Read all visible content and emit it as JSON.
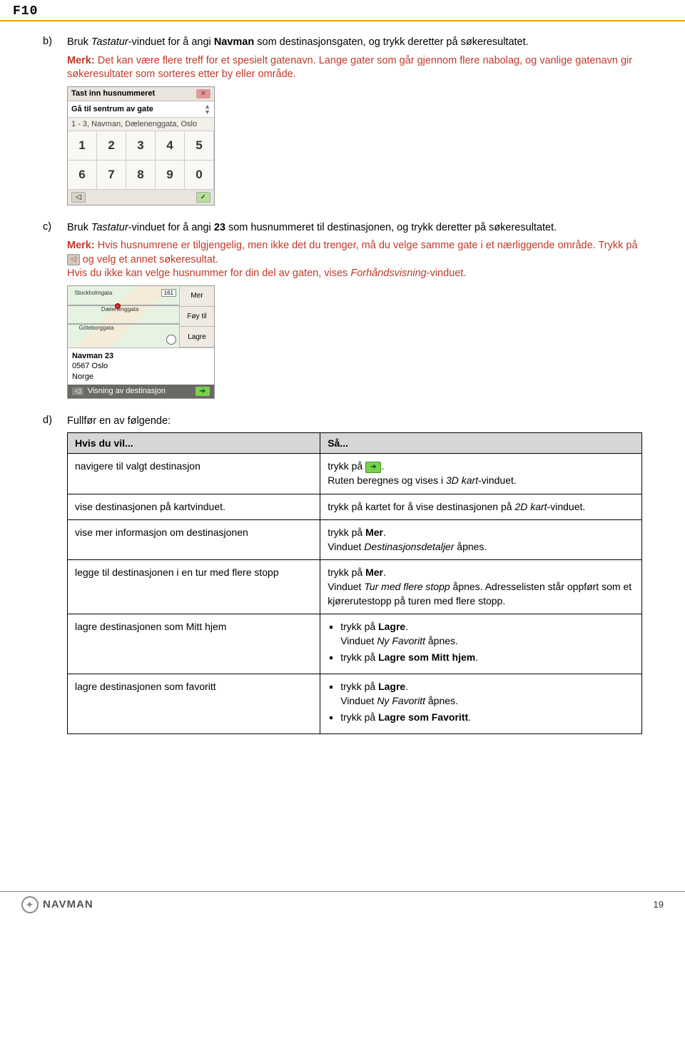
{
  "header": {
    "title": "F10"
  },
  "steps": {
    "b": {
      "letter": "b)",
      "text_pre": "Bruk ",
      "text_italic1": "Tastatur",
      "text_mid1": "-vinduet for å angi ",
      "text_bold1": "Navman",
      "text_post": " som destinasjonsgaten, og trykk deretter på søkeresultatet.",
      "note_label": "Merk:",
      "note_text": " Det kan være flere treff for et spesielt gatenavn. Lange gater som går gjennom flere nabolag, og vanlige gatenavn gir søkeresultater som sorteres etter by eller område."
    },
    "c": {
      "letter": "c)",
      "text_pre": "Bruk ",
      "text_italic1": "Tastatur",
      "text_mid1": "-vinduet for å angi ",
      "text_bold1": "23",
      "text_post": " som husnummeret til destinasjonen, og trykk deretter på søkeresultatet.",
      "note_label": "Merk:",
      "note_line1a": " Hvis husnumrene er tilgjengelig, men ikke det du trenger, må du velge samme gate i et nærliggende område. Trykk på ",
      "note_line1b": " og velg et annet søkeresultat.",
      "note_line2a": "Hvis du ikke kan velge husnummer for din del av gaten, vises ",
      "note_line2_italic": "Forhåndsvisning",
      "note_line2b": "-vinduet."
    },
    "d": {
      "letter": "d)",
      "text": "Fullfør en av følgende:"
    }
  },
  "keypad": {
    "row1": "Tast inn husnummeret",
    "row2": "Gå til sentrum av gate",
    "row3": "1 - 3, Navman, Dælenenggata, Oslo",
    "keys": [
      "1",
      "2",
      "3",
      "4",
      "5",
      "6",
      "7",
      "8",
      "9",
      "0"
    ],
    "back_btn": "◁",
    "ok_btn": "✓"
  },
  "mapshot": {
    "streets": {
      "s1": "Stockholmgata",
      "s2": "Dælenenggata",
      "s3": "Göteborggata"
    },
    "sign": "161",
    "side": {
      "mer": "Mer",
      "foy": "Føy til",
      "lagre": "Lagre"
    },
    "addr": {
      "l1": "Navman 23",
      "l2": "0567 Oslo",
      "l3": "Norge"
    },
    "footer_back": "◁",
    "footer_text": "Visning av destinasjon",
    "footer_go": "➜"
  },
  "table": {
    "h1": "Hvis du vil...",
    "h2": "Så...",
    "rows": [
      {
        "left": "navigere til valgt destinasjon",
        "right_prefix": "trykk på ",
        "right_icon": "go",
        "right_suffix": ".",
        "right_line2a": "Ruten beregnes og vises i ",
        "right_line2_italic": "3D kart",
        "right_line2b": "-vinduet."
      },
      {
        "left": "vise destinasjonen på kartvinduet.",
        "right_plain_a": "trykk på kartet for å vise destinasjonen på ",
        "right_plain_italic": "2D kart",
        "right_plain_b": "-vinduet."
      },
      {
        "left": "vise mer informasjon om destinasjonen",
        "right_l1a": "trykk på ",
        "right_l1_bold": "Mer",
        "right_l1b": ".",
        "right_l2a": "Vinduet ",
        "right_l2_italic": "Destinasjonsdetaljer",
        "right_l2b": " åpnes."
      },
      {
        "left": "legge til destinasjonen i en tur med flere stopp",
        "right_l1a": "trykk på ",
        "right_l1_bold": "Mer",
        "right_l1b": ".",
        "right_l2a": "Vinduet ",
        "right_l2_italic": "Tur med flere stopp",
        "right_l2b": " åpnes. Adresselisten står oppført som et kjørerutestopp på turen med flere stopp."
      },
      {
        "left": "lagre destinasjonen som Mitt hjem",
        "bullets": [
          {
            "a": "trykk på ",
            "bold": "Lagre",
            "b": ".",
            "sub_a": "Vinduet ",
            "sub_i": "Ny Favoritt",
            "sub_b": " åpnes."
          },
          {
            "a": "trykk på ",
            "bold": "Lagre som Mitt hjem",
            "b": "."
          }
        ]
      },
      {
        "left": "lagre destinasjonen som favoritt",
        "bullets": [
          {
            "a": "trykk på ",
            "bold": "Lagre",
            "b": ".",
            "sub_a": "Vinduet ",
            "sub_i": "Ny Favoritt",
            "sub_b": " åpnes."
          },
          {
            "a": "trykk på ",
            "bold": "Lagre som Favoritt",
            "b": "."
          }
        ]
      }
    ]
  },
  "footer": {
    "brand": "NAVMAN",
    "page": "19"
  }
}
